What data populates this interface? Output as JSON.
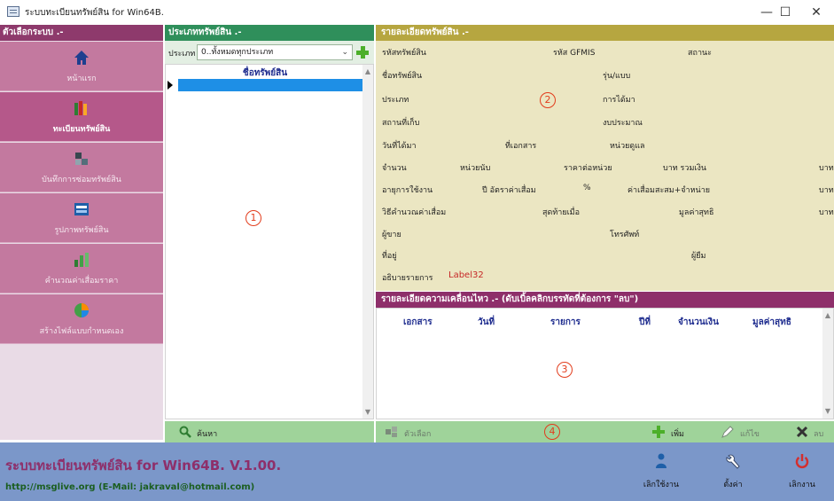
{
  "window": {
    "title": "ระบบทะเบียนทรัพย์สิน for Win64B.",
    "min": "—",
    "max": "☐",
    "close": "✕"
  },
  "sidebar": {
    "header": "ตัวเลือกระบบ .-",
    "items": [
      {
        "label": "หน้าแรก",
        "icon": "home-icon"
      },
      {
        "label": "ทะเบียนทรัพย์สิน",
        "icon": "books-icon"
      },
      {
        "label": "บันทึกการซ่อมทรัพย์สิน",
        "icon": "puzzle-icon"
      },
      {
        "label": "รูปภาพทรัพย์สิน",
        "icon": "picture-icon"
      },
      {
        "label": "คำนวณค่าเสื่อมราคา",
        "icon": "bar-chart-icon"
      },
      {
        "label": "สร้างไฟล์แบบกำหนดเอง",
        "icon": "pie-chart-icon"
      }
    ]
  },
  "panel1": {
    "header": "ประเภททรัพย์สิน .-",
    "filter_label": "ประเภท",
    "filter_value": "0..ทั้งหมดทุกประเภท",
    "column": "ชื่อทรัพย์สิน",
    "marker": "1"
  },
  "panel2": {
    "header": "รายละเอียดทรัพย์สิน .-",
    "marker": "2",
    "labels": {
      "asset_code": "รหัสทรัพย์สิน",
      "gfmis": "รหัส GFMIS",
      "status": "สถานะ",
      "asset_name": "ชื่อทรัพย์สิน",
      "model": "รุ่น/แบบ",
      "type": "ประเภท",
      "acquisition": "การได้มา",
      "location": "สถานที่เก็บ",
      "budget": "งบประมาณ",
      "date_acquired": "วันที่ได้มา",
      "document_no": "ที่เอกสาร",
      "responsible": "หน่วยดูแล",
      "quantity": "จำนวน",
      "unit": "หน่วยนับ",
      "unit_price": "ราคาต่อหน่วย",
      "baht_total": "บาท  รวมเงิน",
      "baht_a": "บาท",
      "life": "อายุการใช้งาน",
      "year_rate": "ปี  อัตราค่าเสื่อม",
      "percent": "%",
      "accum": "ค่าเสื่อมสะสม+จำหน่าย",
      "baht_b": "บาท",
      "method": "วิธีคำนวณค่าเสื่อม",
      "last_date": "สุดท้ายเมื่อ",
      "net_value": "มูลค่าสุทธิ",
      "baht_c": "บาท",
      "seller": "ผู้ขาย",
      "phone": "โทรศัพท์",
      "address": "ที่อยู่",
      "borrower": "ผู้ยืม",
      "description": "อธิบายรายการ",
      "desc_value": "Label32"
    }
  },
  "panel3": {
    "header": "รายละเอียดความเคลื่อนไหว .-  (ดับเบิ้ลคลิกบรรทัดที่ต้องการ \"ลบ\")",
    "columns": [
      "เอกสาร",
      "วันที่",
      "รายการ",
      "ปีที่",
      "จำนวนเงิน",
      "มูลค่าสุทธิ"
    ],
    "marker": "3"
  },
  "toolbar": {
    "search": "ค้นหา",
    "options": "ตัวเลือก",
    "marker": "4",
    "add": "เพิ่ม",
    "edit": "แก้ไข",
    "delete": "ลบ"
  },
  "footer": {
    "title": "ระบบทะเบียนทรัพย์สิน for Win64B. V.1.00.",
    "contact": "http://msglive.org (E-Mail: jakraval@hotmail.com)",
    "buttons": {
      "users": "เลิกใช้งาน",
      "settings": "ตั้งค่า",
      "exit": "เลิกงาน"
    }
  },
  "colors": {
    "sidebar_bg": "#c3799f",
    "green_header": "#2f8f5b",
    "olive_header": "#b6a640",
    "purple_header": "#8e2f6a",
    "footer_bg": "#7b97c9",
    "marker": "#e23c1c"
  }
}
